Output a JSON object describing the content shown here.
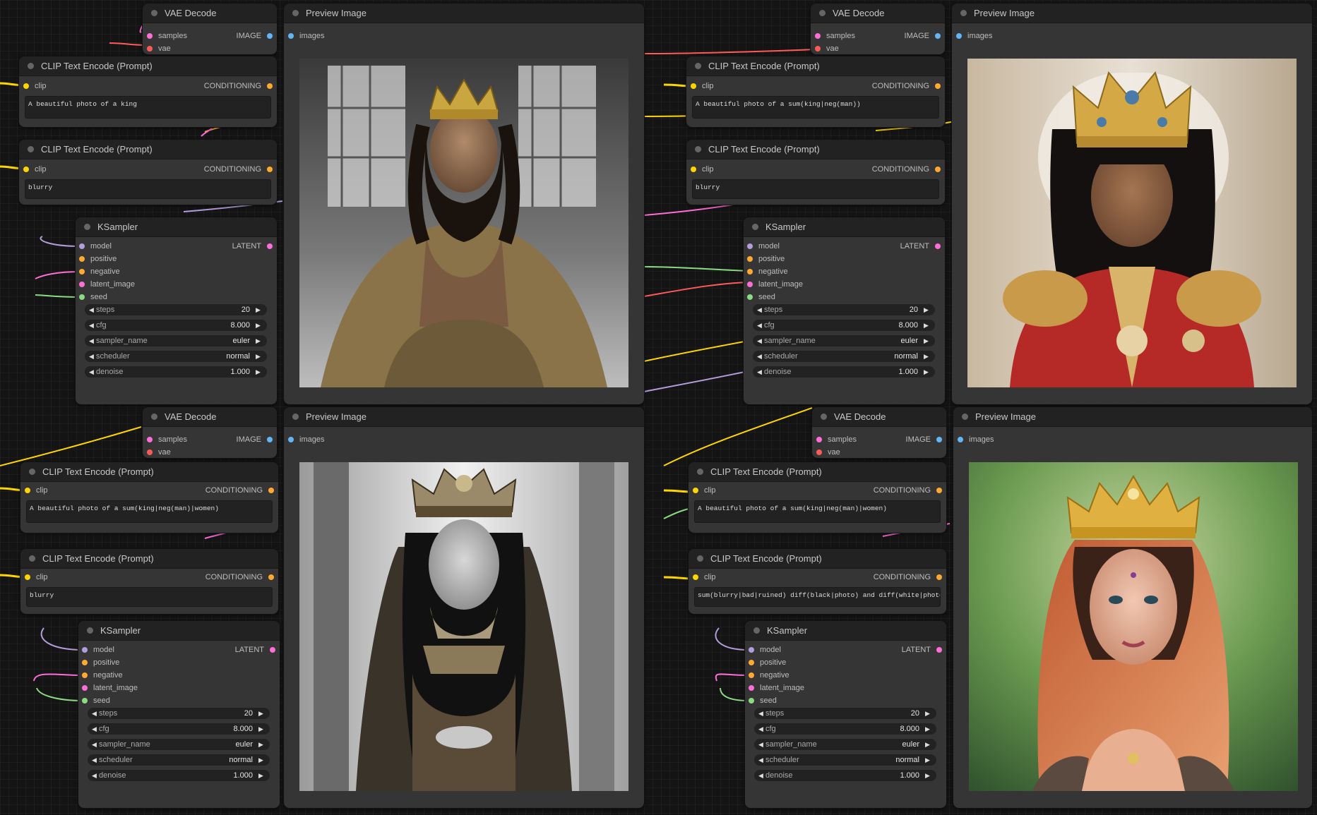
{
  "palette": {
    "canvas": "#141414",
    "node": "#353535",
    "header": "#222222",
    "model": "#b39ddb",
    "conditioning": "#ffa931",
    "clip": "#ffd500",
    "latent": "#ff6ed8",
    "vae": "#ff5a5a",
    "image": "#64b5f6",
    "seed": "#8bdb82"
  },
  "groups": [
    {
      "vae": {
        "title": "VAE Decode",
        "in1": "samples",
        "in2": "vae",
        "out": "IMAGE"
      },
      "clip1": {
        "title": "CLIP Text Encode (Prompt)",
        "in": "clip",
        "out": "CONDITIONING",
        "text": "A beautiful photo of a king"
      },
      "clip2": {
        "title": "CLIP Text Encode (Prompt)",
        "in": "clip",
        "out": "CONDITIONING",
        "text": "blurry"
      },
      "ks": {
        "title": "KSampler",
        "out": "LATENT",
        "inputs": [
          "model",
          "positive",
          "negative",
          "latent_image",
          "seed"
        ],
        "widgets": [
          {
            "label": "steps",
            "value": "20"
          },
          {
            "label": "cfg",
            "value": "8.000"
          },
          {
            "label": "sampler_name",
            "value": "euler"
          },
          {
            "label": "scheduler",
            "value": "normal"
          },
          {
            "label": "denoise",
            "value": "1.000"
          }
        ]
      },
      "preview": {
        "title": "Preview Image",
        "in": "images",
        "image": "king-portrait"
      }
    },
    {
      "vae": {
        "title": "VAE Decode",
        "in1": "samples",
        "in2": "vae",
        "out": "IMAGE"
      },
      "clip1": {
        "title": "CLIP Text Encode (Prompt)",
        "in": "clip",
        "out": "CONDITIONING",
        "text": "A beautiful photo of a sum(king|neg(man))"
      },
      "clip2": {
        "title": "CLIP Text Encode (Prompt)",
        "in": "clip",
        "out": "CONDITIONING",
        "text": "blurry"
      },
      "ks": {
        "title": "KSampler",
        "out": "LATENT",
        "inputs": [
          "model",
          "positive",
          "negative",
          "latent_image",
          "seed"
        ],
        "widgets": [
          {
            "label": "steps",
            "value": "20"
          },
          {
            "label": "cfg",
            "value": "8.000"
          },
          {
            "label": "sampler_name",
            "value": "euler"
          },
          {
            "label": "scheduler",
            "value": "normal"
          },
          {
            "label": "denoise",
            "value": "1.000"
          }
        ]
      },
      "preview": {
        "title": "Preview Image",
        "in": "images",
        "image": "ruler-red-uniform-portrait"
      }
    },
    {
      "vae": {
        "title": "VAE Decode",
        "in1": "samples",
        "in2": "vae",
        "out": "IMAGE"
      },
      "clip1": {
        "title": "CLIP Text Encode (Prompt)",
        "in": "clip",
        "out": "CONDITIONING",
        "text": "A beautiful photo of a sum(king|neg(man)|women)"
      },
      "clip2": {
        "title": "CLIP Text Encode (Prompt)",
        "in": "clip",
        "out": "CONDITIONING",
        "text": "blurry"
      },
      "ks": {
        "title": "KSampler",
        "out": "LATENT",
        "inputs": [
          "model",
          "positive",
          "negative",
          "latent_image",
          "seed"
        ],
        "widgets": [
          {
            "label": "steps",
            "value": "20"
          },
          {
            "label": "cfg",
            "value": "8.000"
          },
          {
            "label": "sampler_name",
            "value": "euler"
          },
          {
            "label": "scheduler",
            "value": "normal"
          },
          {
            "label": "denoise",
            "value": "1.000"
          }
        ]
      },
      "preview": {
        "title": "Preview Image",
        "in": "images",
        "image": "queen-bw-portrait"
      }
    },
    {
      "vae": {
        "title": "VAE Decode",
        "in1": "samples",
        "in2": "vae",
        "out": "IMAGE"
      },
      "clip1": {
        "title": "CLIP Text Encode (Prompt)",
        "in": "clip",
        "out": "CONDITIONING",
        "text": "A beautiful photo of a sum(king|neg(man)|women)"
      },
      "clip2": {
        "title": "CLIP Text Encode (Prompt)",
        "in": "clip",
        "out": "CONDITIONING",
        "text": "sum(blurry|bad|ruined) diff(black|photo) and diff(white|photo)"
      },
      "ks": {
        "title": "KSampler",
        "out": "LATENT",
        "inputs": [
          "model",
          "positive",
          "negative",
          "latent_image",
          "seed"
        ],
        "widgets": [
          {
            "label": "steps",
            "value": "20"
          },
          {
            "label": "cfg",
            "value": "8.000"
          },
          {
            "label": "sampler_name",
            "value": "euler"
          },
          {
            "label": "scheduler",
            "value": "normal"
          },
          {
            "label": "denoise",
            "value": "1.000"
          }
        ]
      },
      "preview": {
        "title": "Preview Image",
        "in": "images",
        "image": "queen-color-portrait"
      }
    }
  ]
}
